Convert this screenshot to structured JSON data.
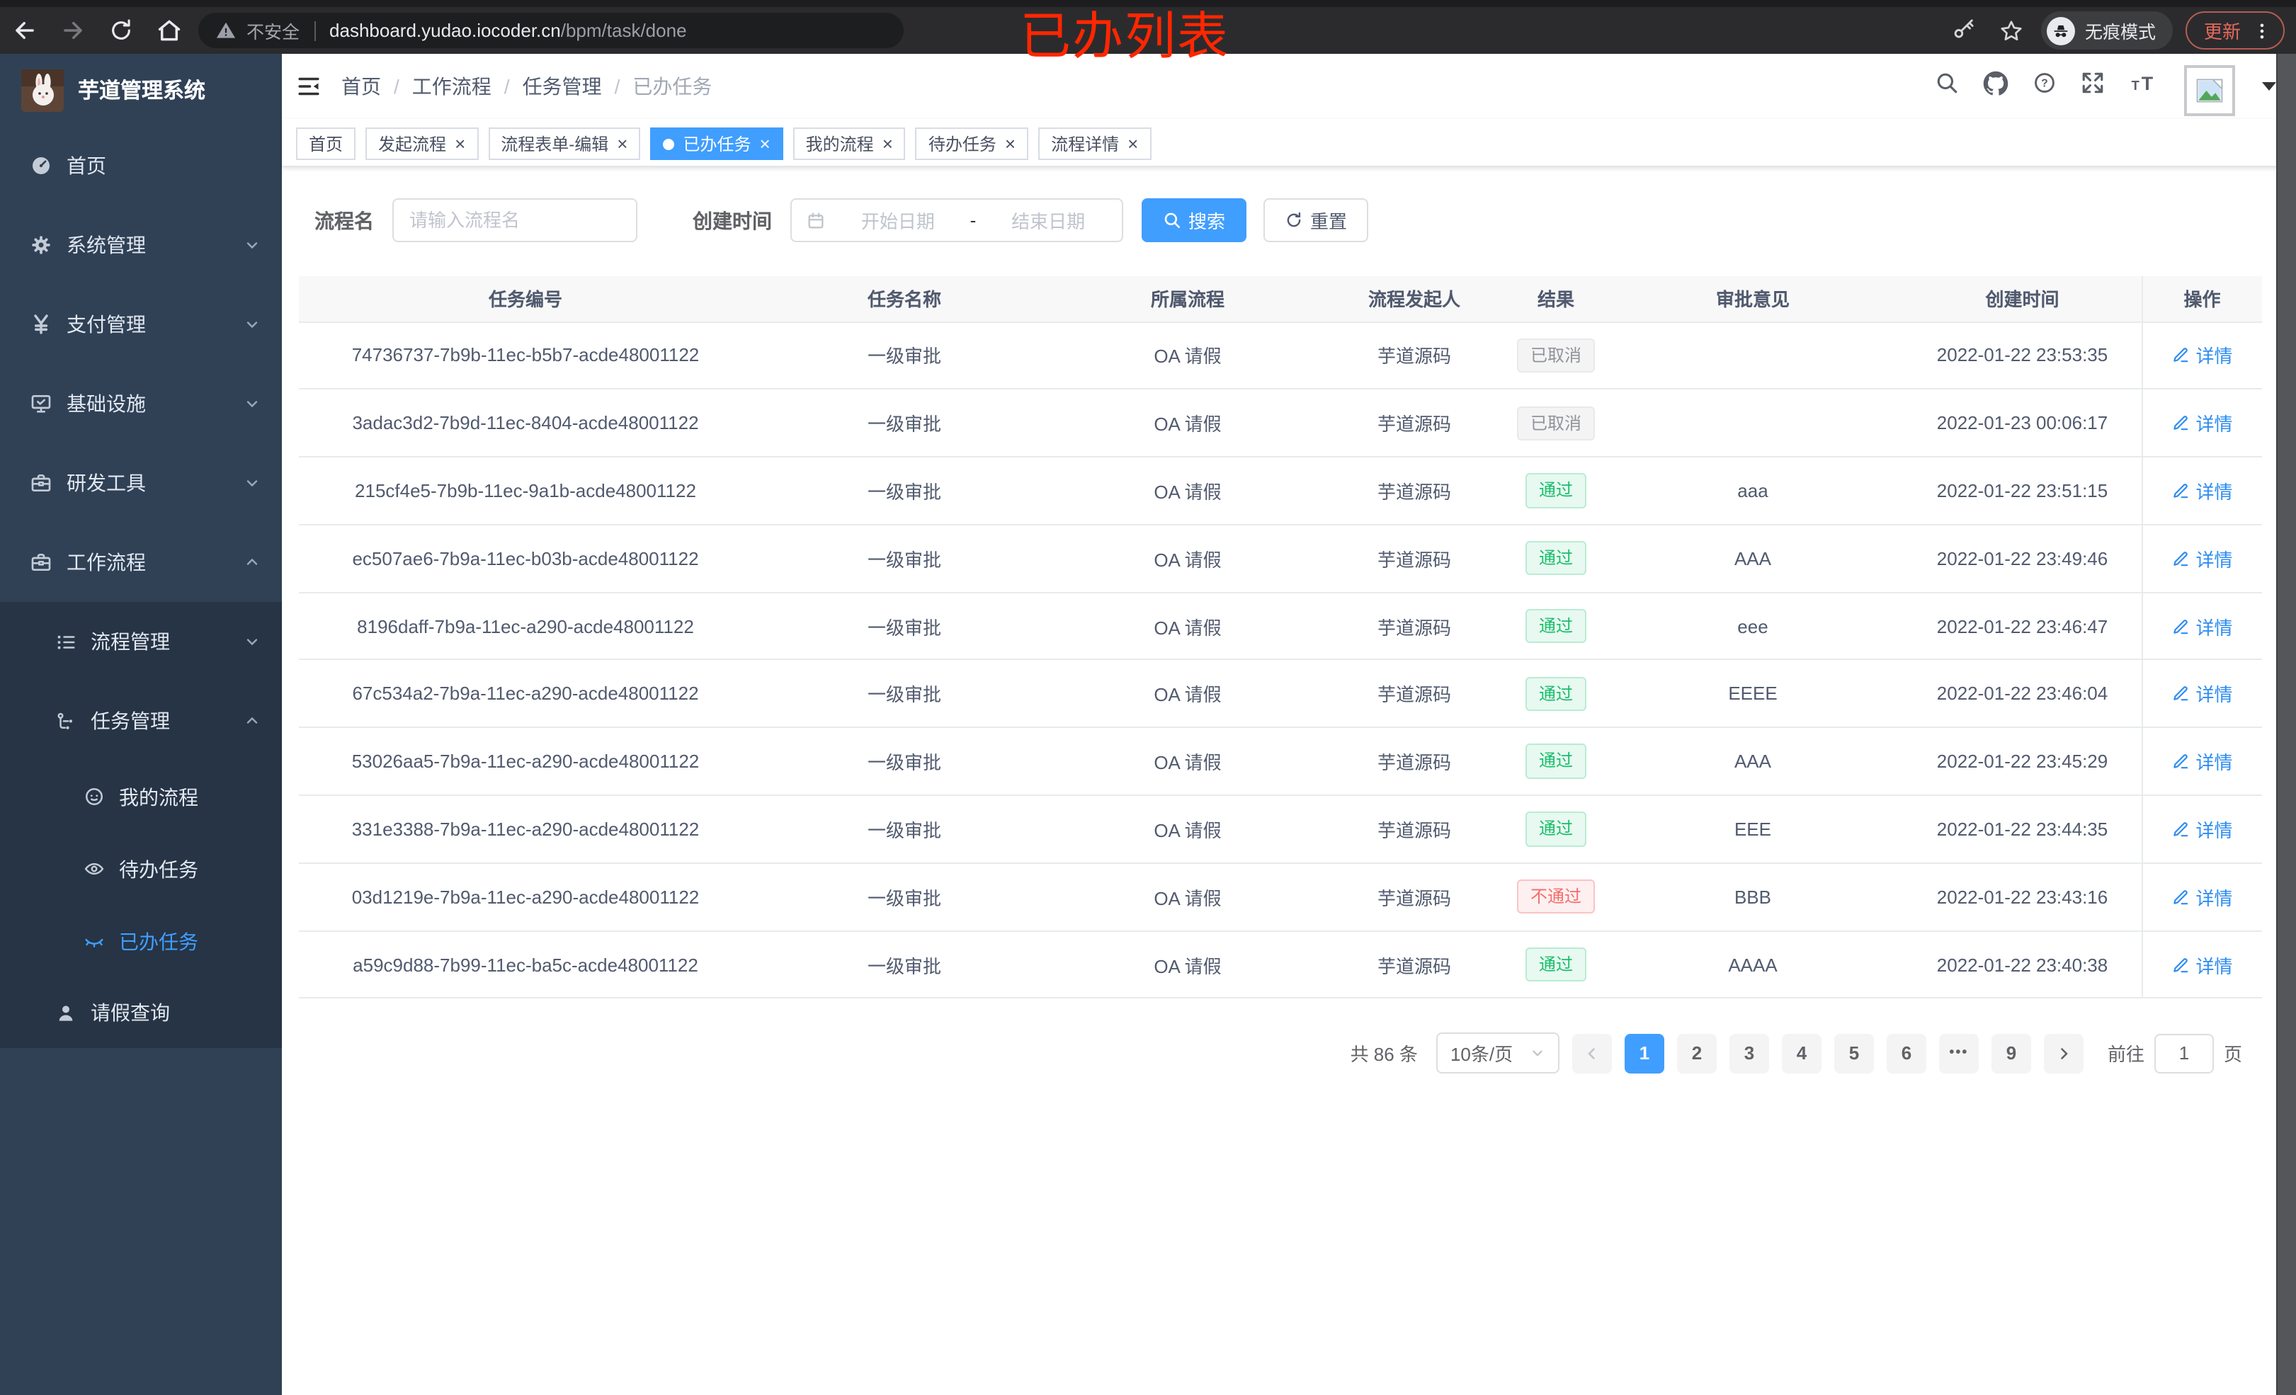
{
  "colors": {
    "accent": "#409eff",
    "success": "#19be6b",
    "danger": "#f56c6c",
    "info": "#909399",
    "sidebar_bg": "#304156",
    "annotation_red": "#ff2600"
  },
  "browser": {
    "security_label": "不安全",
    "url_host": "dashboard.yudao.iocoder.cn",
    "url_path": "/bpm/task/done",
    "incognito_label": "无痕模式",
    "update_label": "更新",
    "annotation": "已办列表"
  },
  "sidebar": {
    "logo_title": "芋道管理系统",
    "items": [
      {
        "label": "首页"
      },
      {
        "label": "系统管理"
      },
      {
        "label": "支付管理"
      },
      {
        "label": "基础设施"
      },
      {
        "label": "研发工具"
      },
      {
        "label": "工作流程"
      },
      {
        "label": "流程管理"
      },
      {
        "label": "任务管理"
      },
      {
        "label": "我的流程"
      },
      {
        "label": "待办任务"
      },
      {
        "label": "已办任务"
      },
      {
        "label": "请假查询"
      }
    ]
  },
  "breadcrumb": {
    "separator": "/",
    "items": [
      "首页",
      "工作流程",
      "任务管理",
      "已办任务"
    ]
  },
  "tabs": [
    {
      "label": "首页",
      "close": "",
      "state": ""
    },
    {
      "label": "发起流程",
      "close": "×",
      "state": ""
    },
    {
      "label": "流程表单-编辑",
      "close": "×",
      "state": ""
    },
    {
      "label": "已办任务",
      "close": "×",
      "state": "active"
    },
    {
      "label": "我的流程",
      "close": "×",
      "state": ""
    },
    {
      "label": "待办任务",
      "close": "×",
      "state": ""
    },
    {
      "label": "流程详情",
      "close": "×",
      "state": ""
    }
  ],
  "filters": {
    "name_label": "流程名",
    "name_placeholder": "请输入流程名",
    "date_label": "创建时间",
    "date_start_placeholder": "开始日期",
    "date_separator": "-",
    "date_end_placeholder": "结束日期",
    "search_label": "搜索",
    "reset_label": "重置"
  },
  "table": {
    "action_label": "详情",
    "headers": [
      "任务编号",
      "任务名称",
      "所属流程",
      "流程发起人",
      "结果",
      "审批意见",
      "创建时间",
      "操作"
    ],
    "rows": [
      {
        "id": "74736737-7b9b-11ec-b5b7-acde48001122",
        "name": "一级审批",
        "process": "OA 请假",
        "starter": "芋道源码",
        "result": "已取消",
        "result_type": "cancel",
        "opinion": "",
        "created": "2022-01-22 23:53:35"
      },
      {
        "id": "3adac3d2-7b9d-11ec-8404-acde48001122",
        "name": "一级审批",
        "process": "OA 请假",
        "starter": "芋道源码",
        "result": "已取消",
        "result_type": "cancel",
        "opinion": "",
        "created": "2022-01-23 00:06:17"
      },
      {
        "id": "215cf4e5-7b9b-11ec-9a1b-acde48001122",
        "name": "一级审批",
        "process": "OA 请假",
        "starter": "芋道源码",
        "result": "通过",
        "result_type": "pass",
        "opinion": "aaa",
        "created": "2022-01-22 23:51:15"
      },
      {
        "id": "ec507ae6-7b9a-11ec-b03b-acde48001122",
        "name": "一级审批",
        "process": "OA 请假",
        "starter": "芋道源码",
        "result": "通过",
        "result_type": "pass",
        "opinion": "AAA",
        "created": "2022-01-22 23:49:46"
      },
      {
        "id": "8196daff-7b9a-11ec-a290-acde48001122",
        "name": "一级审批",
        "process": "OA 请假",
        "starter": "芋道源码",
        "result": "通过",
        "result_type": "pass",
        "opinion": "eee",
        "created": "2022-01-22 23:46:47"
      },
      {
        "id": "67c534a2-7b9a-11ec-a290-acde48001122",
        "name": "一级审批",
        "process": "OA 请假",
        "starter": "芋道源码",
        "result": "通过",
        "result_type": "pass",
        "opinion": "EEEE",
        "created": "2022-01-22 23:46:04"
      },
      {
        "id": "53026aa5-7b9a-11ec-a290-acde48001122",
        "name": "一级审批",
        "process": "OA 请假",
        "starter": "芋道源码",
        "result": "通过",
        "result_type": "pass",
        "opinion": "AAA",
        "created": "2022-01-22 23:45:29"
      },
      {
        "id": "331e3388-7b9a-11ec-a290-acde48001122",
        "name": "一级审批",
        "process": "OA 请假",
        "starter": "芋道源码",
        "result": "通过",
        "result_type": "pass",
        "opinion": "EEE",
        "created": "2022-01-22 23:44:35"
      },
      {
        "id": "03d1219e-7b9a-11ec-a290-acde48001122",
        "name": "一级审批",
        "process": "OA 请假",
        "starter": "芋道源码",
        "result": "不通过",
        "result_type": "fail",
        "opinion": "BBB",
        "created": "2022-01-22 23:43:16"
      },
      {
        "id": "a59c9d88-7b99-11ec-ba5c-acde48001122",
        "name": "一级审批",
        "process": "OA 请假",
        "starter": "芋道源码",
        "result": "通过",
        "result_type": "pass",
        "opinion": "AAAA",
        "created": "2022-01-22 23:40:38"
      }
    ]
  },
  "pagination": {
    "total_label": "共 86 条",
    "page_size": "10条/页",
    "pages": [
      {
        "label": "1",
        "state": "active"
      },
      {
        "label": "2",
        "state": ""
      },
      {
        "label": "3",
        "state": ""
      },
      {
        "label": "4",
        "state": ""
      },
      {
        "label": "5",
        "state": ""
      },
      {
        "label": "6",
        "state": ""
      },
      {
        "label": "•••",
        "state": "ellipsis"
      },
      {
        "label": "9",
        "state": ""
      }
    ],
    "goto_label": "前往",
    "goto_value": "1",
    "goto_unit": "页"
  }
}
